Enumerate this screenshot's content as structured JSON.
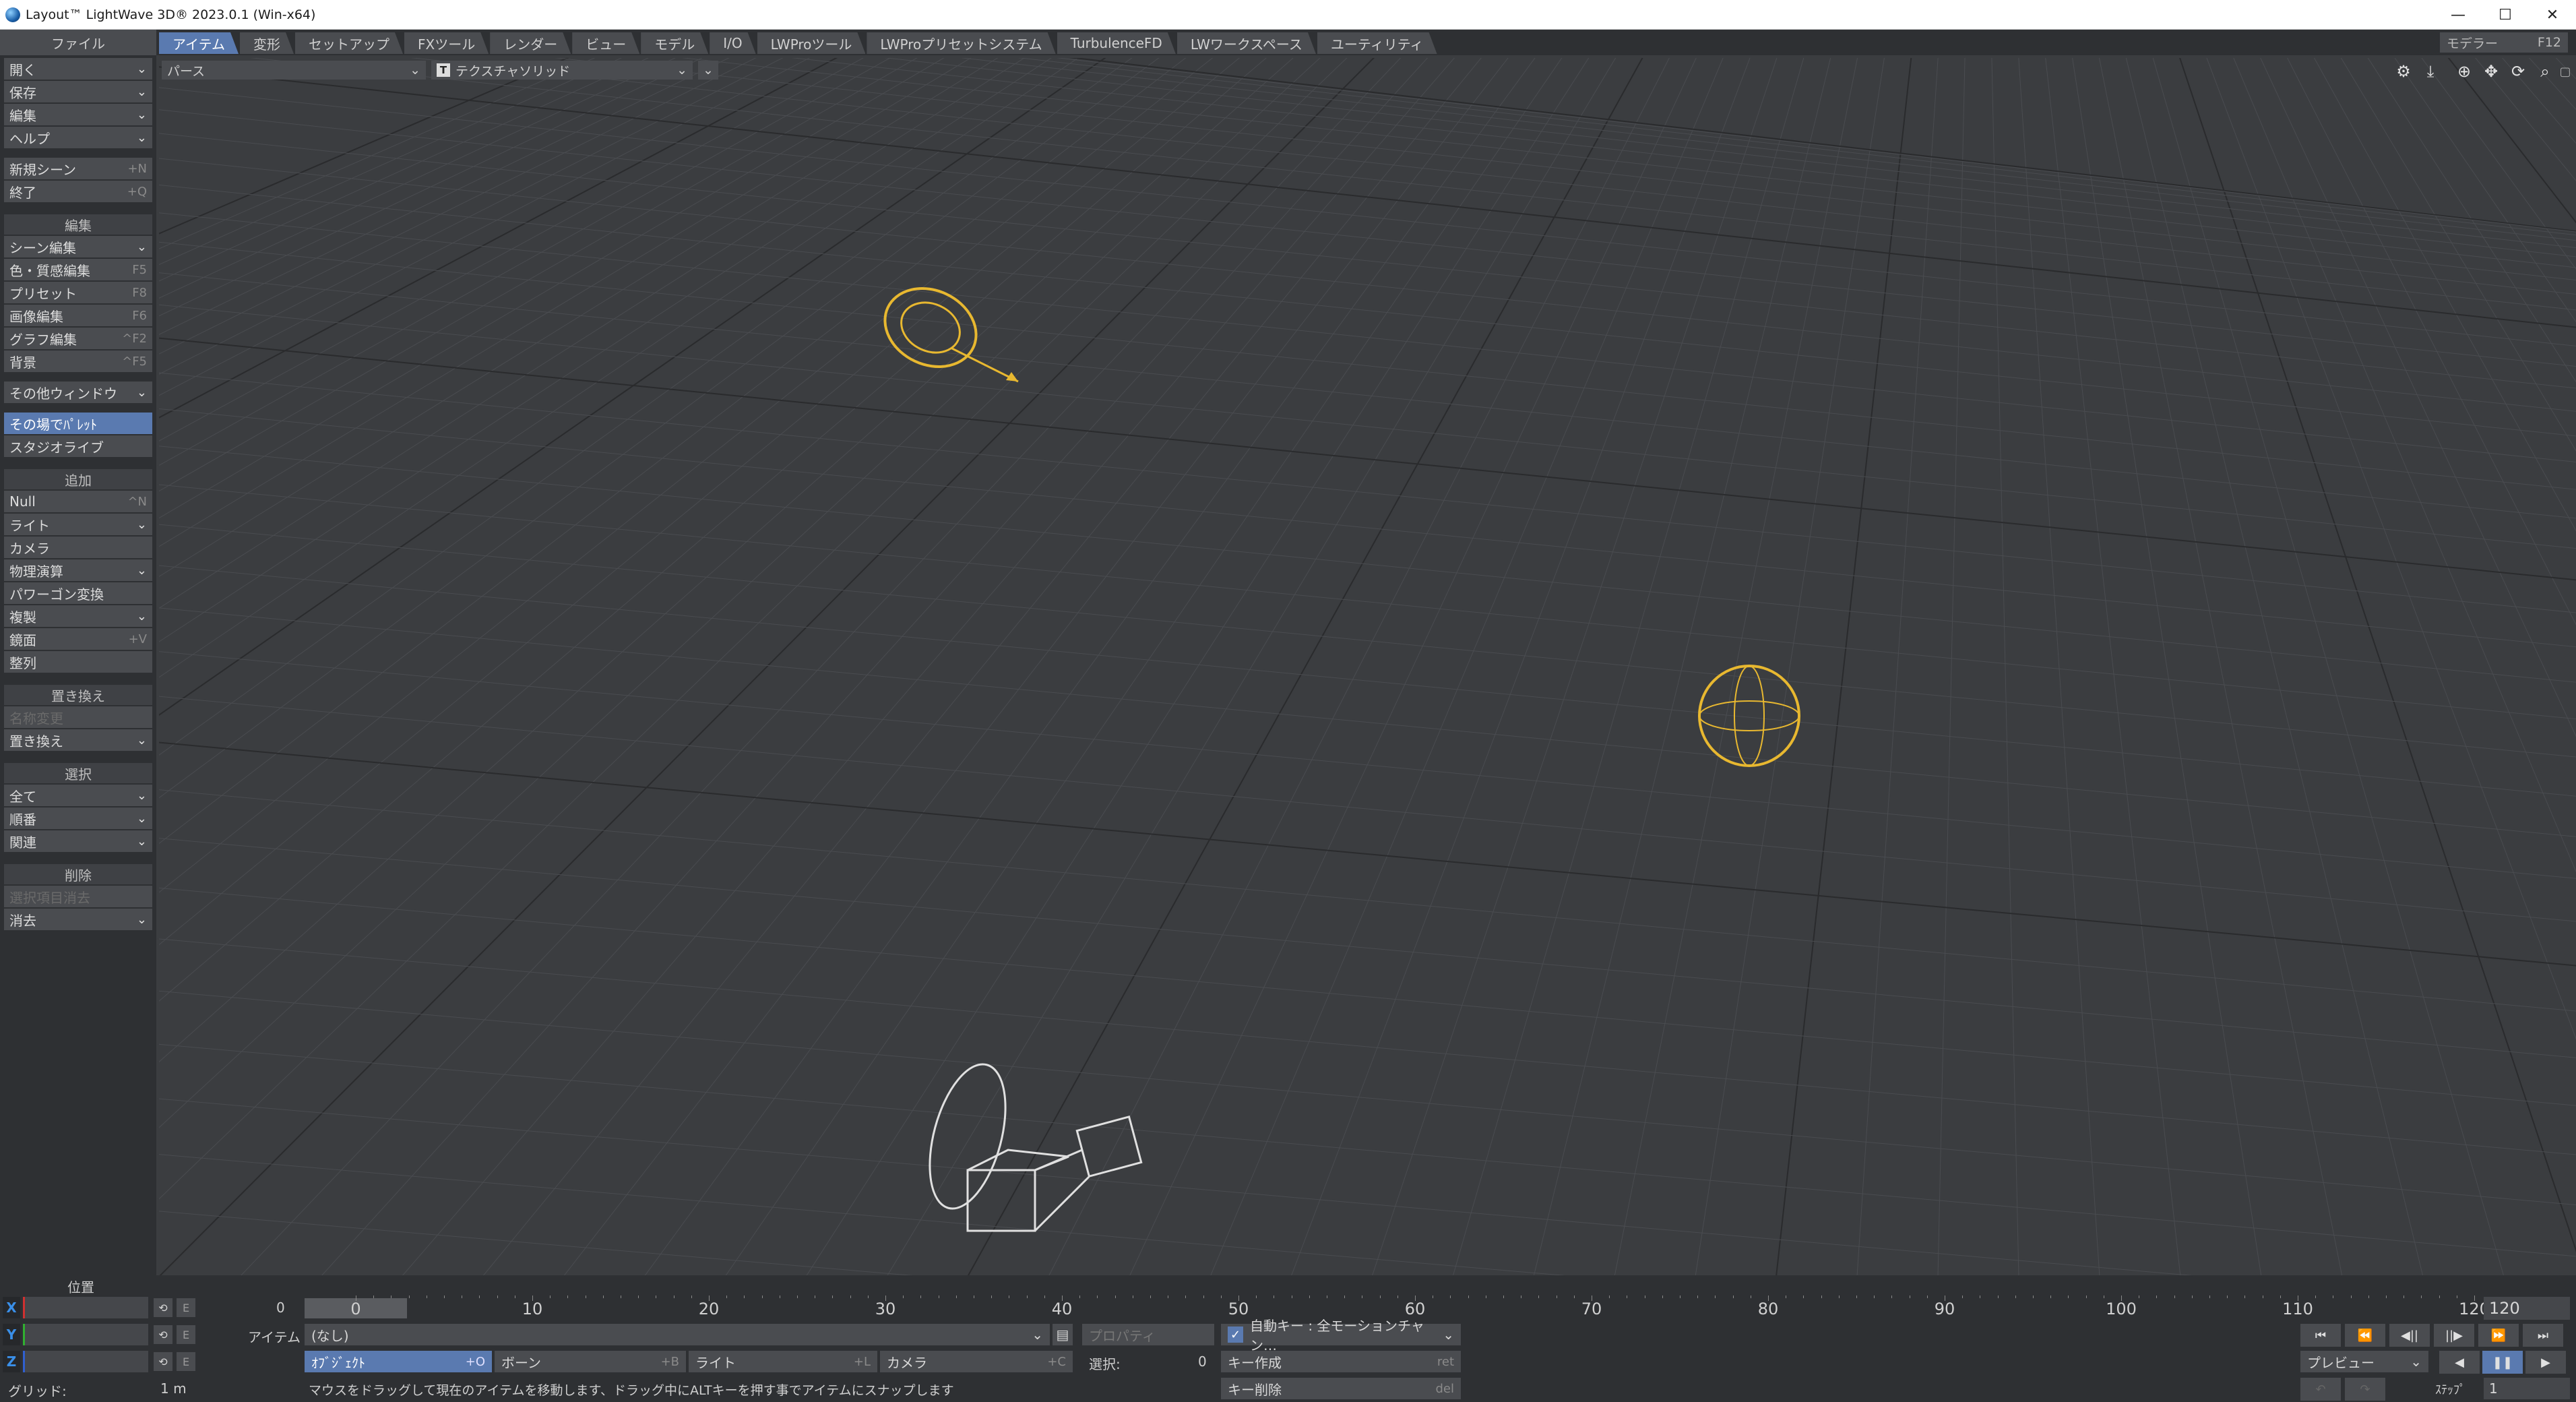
{
  "window": {
    "title": "Layout™ LightWave 3D® 2023.0.1 (Win-x64)",
    "controls": {
      "minimize": "—",
      "maximize": "☐",
      "close": "✕"
    }
  },
  "menubar": {
    "file_header": "ファイル",
    "tabs": [
      "アイテム",
      "変形",
      "セットアップ",
      "FXツール",
      "レンダー",
      "ビュー",
      "モデル",
      "I/O",
      "LWProツール",
      "LWProプリセットシステム",
      "TurbulenceFD",
      "LWワークスペース",
      "ユーティリティ"
    ],
    "active_tab": 0,
    "modeler_label": "モデラー",
    "modeler_shortcut": "F12"
  },
  "lefttoolbar": {
    "file_items": [
      {
        "label": "開く",
        "dropdown": true
      },
      {
        "label": "保存",
        "dropdown": true
      },
      {
        "label": "編集",
        "dropdown": true
      },
      {
        "label": "ヘルプ",
        "dropdown": true
      }
    ],
    "file_items2": [
      {
        "label": "新規シーン",
        "shortcut": "+N"
      },
      {
        "label": "終了",
        "shortcut": "+Q"
      }
    ],
    "edit_header": "編集",
    "edit_items": [
      {
        "label": "シーン編集",
        "dropdown": true
      },
      {
        "label": "色・質感編集",
        "shortcut": "F5"
      },
      {
        "label": "プリセット",
        "shortcut": "F8"
      },
      {
        "label": "画像編集",
        "shortcut": "F6"
      },
      {
        "label": "グラフ編集",
        "shortcut": "^F2"
      },
      {
        "label": "背景",
        "shortcut": "^F5"
      }
    ],
    "other_window": "その他ウィンドウ",
    "palette_item": "その場でﾊﾟﾚｯﾄ",
    "studio_live": "スタジオライブ",
    "add_header": "追加",
    "add_items": [
      {
        "label": "Null",
        "shortcut": "^N"
      },
      {
        "label": "ライト",
        "dropdown": true
      },
      {
        "label": "カメラ"
      },
      {
        "label": "物理演算",
        "dropdown": true
      },
      {
        "label": "パワーゴン変換"
      },
      {
        "label": "複製",
        "dropdown": true
      },
      {
        "label": "鏡面",
        "shortcut": "+V"
      },
      {
        "label": "整列"
      }
    ],
    "replace_header": "置き換え",
    "rename": "名称変更",
    "replace_item": "置き換え",
    "select_header": "選択",
    "select_items": [
      {
        "label": "全て",
        "dropdown": true
      },
      {
        "label": "順番",
        "dropdown": true
      },
      {
        "label": "関連",
        "dropdown": true
      }
    ],
    "delete_header": "削除",
    "delete_selected": "選択項目消去",
    "clear_item": "消去"
  },
  "viewport": {
    "view_mode": "パース",
    "render_style": "テクスチャソリッド",
    "render_style_icon": "T"
  },
  "bottom": {
    "position_label": "位置",
    "axes": [
      "X",
      "Y",
      "Z"
    ],
    "axis_colors": {
      "X": "#3a8fe8",
      "Y": "#3a8fe8",
      "Z": "#3a8fe8"
    },
    "timeline": {
      "current_frame": "0",
      "start_label": "0",
      "ticks": [
        "10",
        "20",
        "30",
        "40",
        "50",
        "60",
        "70",
        "80",
        "90",
        "100",
        "110",
        "120"
      ],
      "end_frame": "120"
    },
    "item_label": "アイテム",
    "item_value": "(なし)",
    "properties": "プロパティ",
    "auto_key": "自動キー : 全モーションチャン…",
    "object_btn": "ｵﾌﾞｼﾞｪｸﾄ",
    "object_sc": "+O",
    "bone_btn": "ボーン",
    "bone_sc": "+B",
    "light_btn": "ライト",
    "light_sc": "+L",
    "camera_btn": "カメラ",
    "camera_sc": "+C",
    "selected_label": "選択:",
    "selected_value": "0",
    "create_key": "キー作成",
    "create_key_sc": "ret",
    "delete_key": "キー削除",
    "delete_key_sc": "del",
    "grid_label": "グリッド:",
    "grid_value": "1 m",
    "status_message": "マウスをドラッグして現在のアイテムを移動します、ドラッグ中にALTキーを押す事でアイテムにスナップします",
    "preview": "プレビュー",
    "step_label": "ｽﾃｯﾌﾟ",
    "step_value": "1",
    "playback_icons": [
      "⏮",
      "⏪",
      "◀||",
      "||▶",
      "⏩",
      "⏭"
    ]
  }
}
